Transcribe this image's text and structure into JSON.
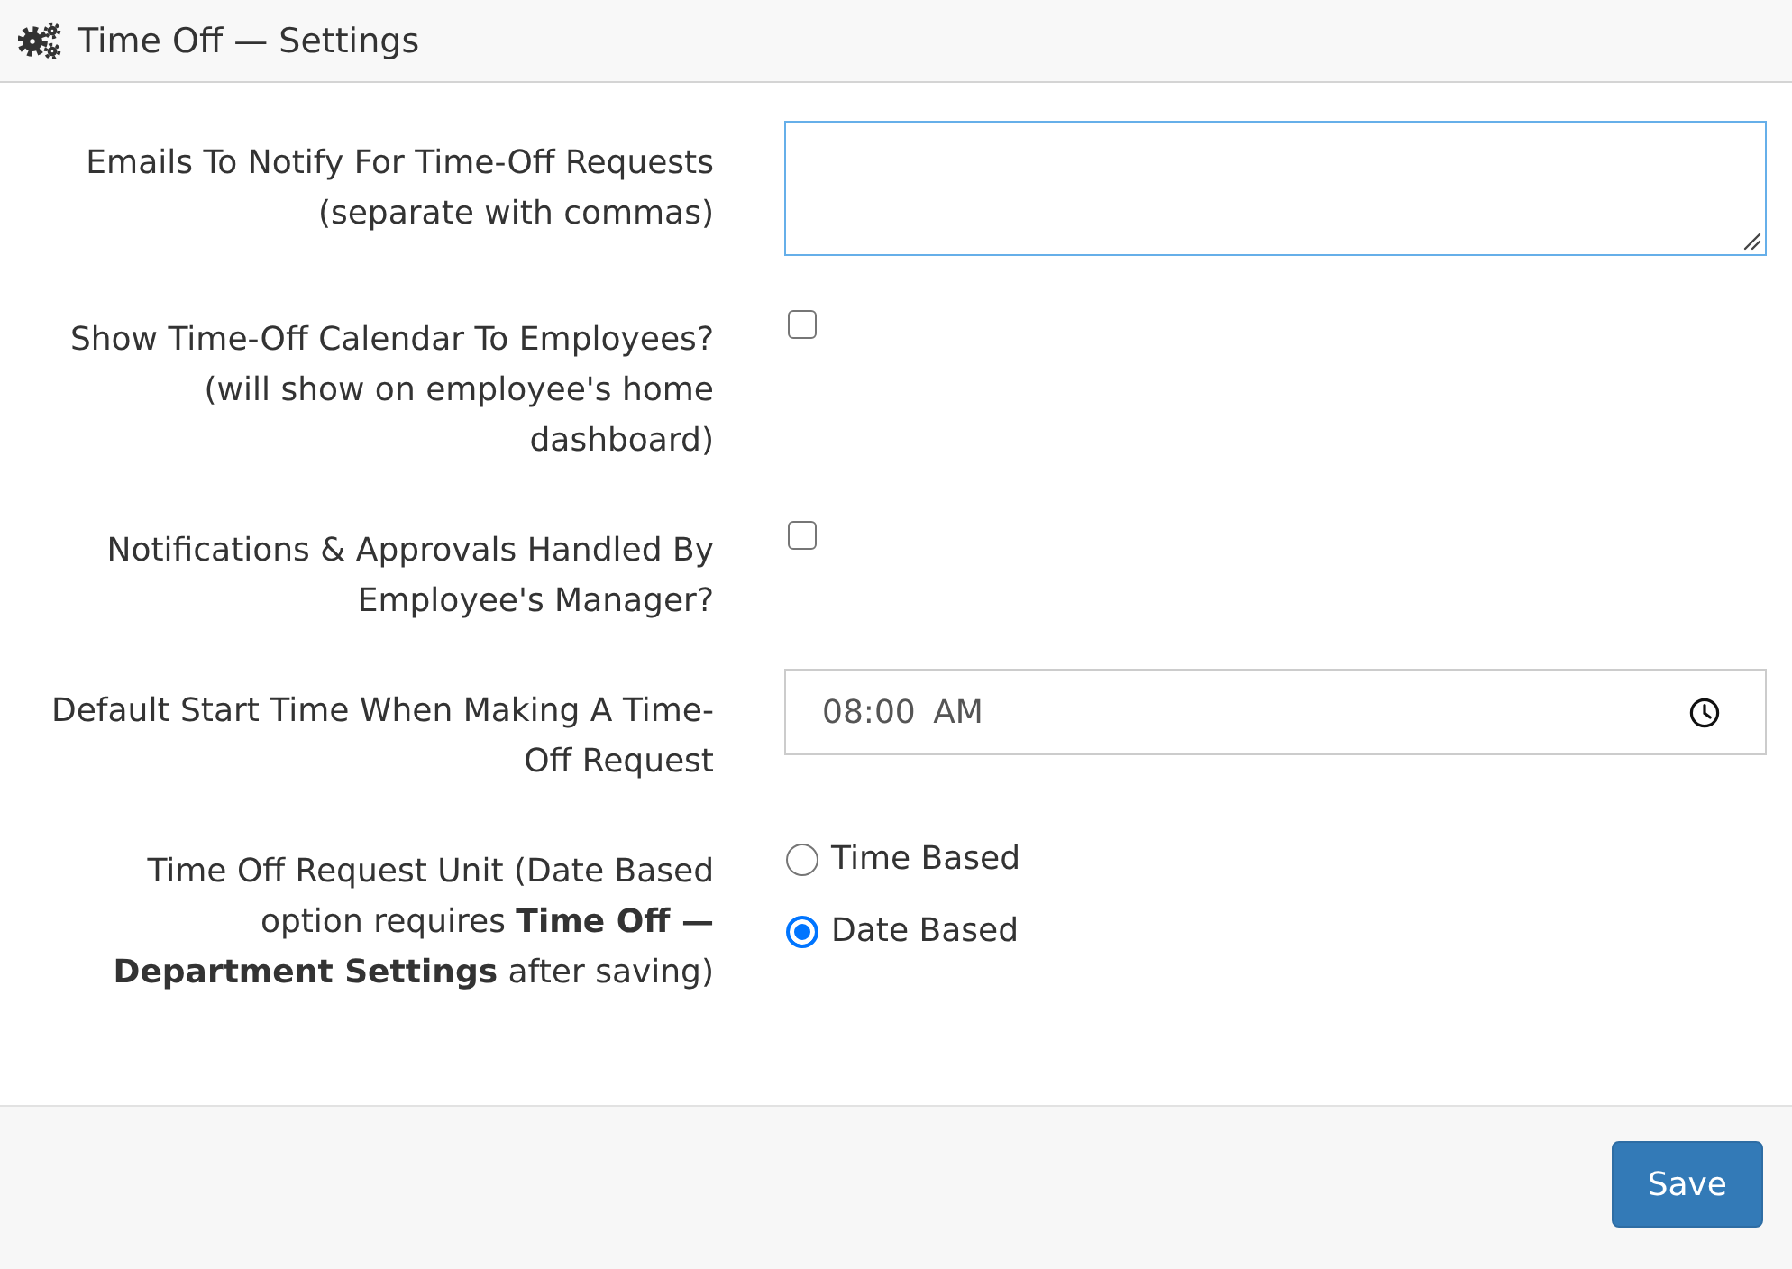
{
  "header": {
    "title": "Time Off — Settings"
  },
  "fields": [
    {
      "kind": "textarea",
      "label": "Emails To Notify For Time-Off Requests (separate with commas)",
      "focused": true
    },
    {
      "kind": "checkbox",
      "label": "Show Time-Off Calendar To Employees? (will show on employee's home dashboard)",
      "checked": false
    },
    {
      "kind": "checkbox",
      "label": "Notifications & Approvals Handled By Employee's Manager?",
      "checked": false
    },
    {
      "kind": "time",
      "label": "Default Start Time When Making A Time-Off Request",
      "value": "08:00 AM"
    },
    {
      "kind": "radio",
      "label": "Time Off Request Unit (Date Based option requires **Time Off — Department Settings** after saving)",
      "options": [
        {
          "label": "Time Based",
          "selected": false
        },
        {
          "label": "Date Based",
          "selected": true
        }
      ]
    }
  ],
  "footer": {
    "buttons": [
      "Save"
    ]
  }
}
